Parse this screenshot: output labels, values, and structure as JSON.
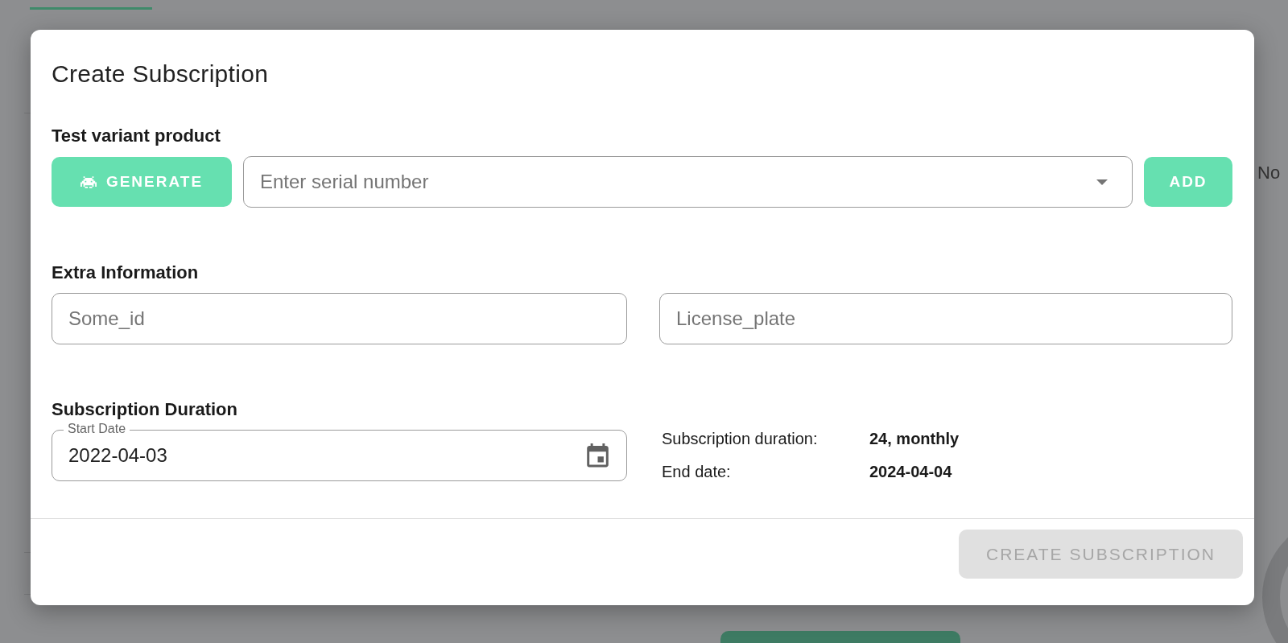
{
  "background": {
    "side_text": "No"
  },
  "dialog": {
    "title": "Create Subscription",
    "product": {
      "heading": "Test variant product",
      "generate_button": "GENERATE",
      "serial_field": {
        "placeholder": "Enter serial number"
      },
      "add_button": "ADD"
    },
    "extra": {
      "heading": "Extra Information",
      "fields": [
        {
          "placeholder": "Some_id"
        },
        {
          "placeholder": "License_plate"
        }
      ]
    },
    "duration": {
      "heading": "Subscription Duration",
      "start_date": {
        "label": "Start Date",
        "value": "2022-04-03"
      },
      "summary": [
        {
          "label": "Subscription duration:",
          "value": "24, monthly"
        },
        {
          "label": "End date:",
          "value": "2024-04-04"
        }
      ]
    },
    "create_button": {
      "label": "CREATE SUBSCRIPTION",
      "disabled": true
    }
  }
}
